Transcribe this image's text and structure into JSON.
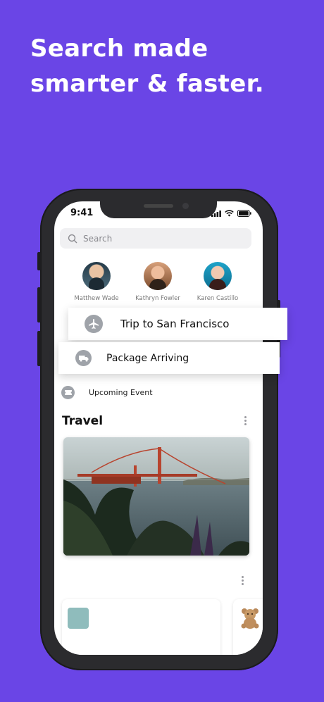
{
  "headline": {
    "line1": "Search made",
    "line2": "smarter & faster."
  },
  "status_bar": {
    "time": "9:41"
  },
  "search": {
    "placeholder": "Search"
  },
  "contacts": [
    {
      "name": "Matthew Wade"
    },
    {
      "name": "Kathryn Fowler"
    },
    {
      "name": "Karen Castillo"
    }
  ],
  "results": {
    "trip": "Trip to San Francisco",
    "package": "Package Arriving",
    "event": "Upcoming Event"
  },
  "section": {
    "title": "Travel"
  },
  "colors": {
    "background": "#6a45e6",
    "phone_frame": "#2b2b2e",
    "icon_circle": "#9fa3a9"
  },
  "icons": [
    "search-icon",
    "airplane-icon",
    "truck-icon",
    "ticket-icon",
    "more-vertical-icon",
    "signal-icon",
    "wifi-icon",
    "battery-icon",
    "teddy-bear-icon"
  ]
}
